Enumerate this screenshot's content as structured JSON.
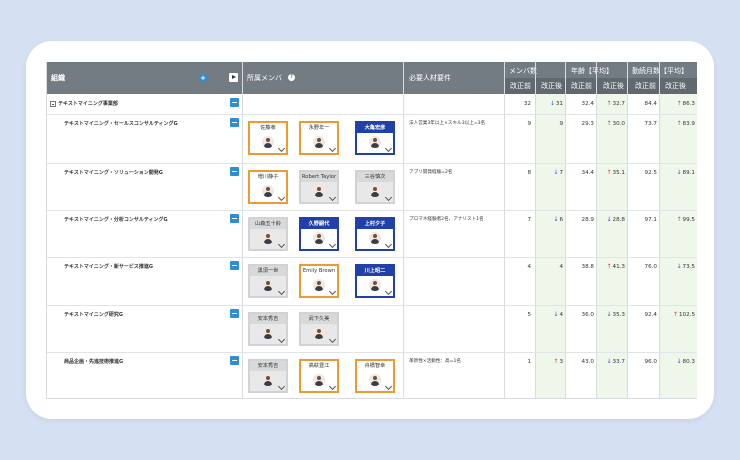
{
  "header": {
    "org": "組織",
    "members": "所属メンバ",
    "help": "?",
    "add": "+",
    "required": "必要人材要件",
    "member_count": "メンバ数",
    "age": "年齢【平均】",
    "tenure": "勤続月数【平均】",
    "before": "改正前",
    "after": "改正後"
  },
  "colors": {
    "header": "#737b83",
    "subheader": "#606870",
    "up": "#d63b2e",
    "down": "#2a56c9",
    "orange_chip": "#ee9a33",
    "blue_chip": "#2241a8",
    "toggle": "#2d8ed6"
  },
  "rows": [
    {
      "org": "テキストマイニング事業部",
      "req": "",
      "members": [],
      "m_before": "32",
      "m_after": "31",
      "m_dir": "down",
      "a_before": "32.4",
      "a_after": "32.7",
      "a_dir": "up",
      "t_before": "84.4",
      "t_after": "86.3",
      "t_dir": "up"
    },
    {
      "org": "テキストマイニング・セールスコンサルティングG",
      "req": "法人営業3年以上×スキル3以上=3名",
      "members": [
        {
          "name": "佐藤孝",
          "style": "orange"
        },
        {
          "name": "永野年一",
          "style": "orange"
        },
        {
          "name": "大亀宏彦",
          "style": "blue"
        }
      ],
      "m_before": "9",
      "m_after": "9",
      "m_dir": "",
      "a_before": "29.3",
      "a_after": "30.0",
      "a_dir": "up",
      "t_before": "73.7",
      "t_after": "83.9",
      "t_dir": "up"
    },
    {
      "org": "テキストマイニング・ソリューション開発G",
      "req": "アプリ開発経験=2名",
      "members": [
        {
          "name": "増川静子",
          "style": "orange"
        },
        {
          "name": "Robert Taylor",
          "style": "gray"
        },
        {
          "name": "三谷慎次",
          "style": "gray"
        }
      ],
      "m_before": "8",
      "m_after": "7",
      "m_dir": "down",
      "a_before": "34.4",
      "a_after": "35.1",
      "a_dir": "up",
      "t_before": "92.5",
      "t_after": "89.1",
      "t_dir": "down"
    },
    {
      "org": "テキストマイニング・分析コンサルティングG",
      "req": "プロマネ経験者2名、アナリスト1名",
      "members": [
        {
          "name": "山森五十鈴",
          "style": "gray"
        },
        {
          "name": "久野嗣代",
          "style": "blue"
        },
        {
          "name": "上村夕子",
          "style": "blue"
        }
      ],
      "m_before": "7",
      "m_after": "6",
      "m_dir": "down",
      "a_before": "28.9",
      "a_after": "28.8",
      "a_dir": "down",
      "t_before": "97.1",
      "t_after": "99.5",
      "t_dir": "up"
    },
    {
      "org": "テキストマイニング・新サービス推進G",
      "req": "",
      "members": [
        {
          "name": "黒須一世",
          "style": "gray"
        },
        {
          "name": "Emily Brown",
          "style": "orange"
        },
        {
          "name": "川上昭二",
          "style": "blue"
        }
      ],
      "m_before": "4",
      "m_after": "4",
      "m_dir": "",
      "a_before": "38.8",
      "a_after": "41.3",
      "a_dir": "up",
      "t_before": "76.0",
      "t_after": "73.5",
      "t_dir": "down"
    },
    {
      "org": "テキストマイニング研究G",
      "req": "",
      "members": [
        {
          "name": "安本秀吉",
          "style": "gray"
        },
        {
          "name": "武下久美",
          "style": "gray"
        }
      ],
      "m_before": "5",
      "m_after": "4",
      "m_dir": "down",
      "a_before": "36.0",
      "a_after": "35.3",
      "a_dir": "down",
      "t_before": "92.4",
      "t_after": "102.5",
      "t_dir": "up"
    },
    {
      "org": "商品企画・先進技術推進G",
      "req": "革新性×活動性：高=1名",
      "members": [
        {
          "name": "安本秀吉",
          "style": "gray"
        },
        {
          "name": "高萩豊江",
          "style": "orange"
        },
        {
          "name": "舟橋智幸",
          "style": "orange"
        }
      ],
      "m_before": "1",
      "m_after": "3",
      "m_dir": "up",
      "a_before": "43.0",
      "a_after": "33.7",
      "a_dir": "down",
      "t_before": "96.0",
      "t_after": "80.3",
      "t_dir": "down"
    }
  ]
}
